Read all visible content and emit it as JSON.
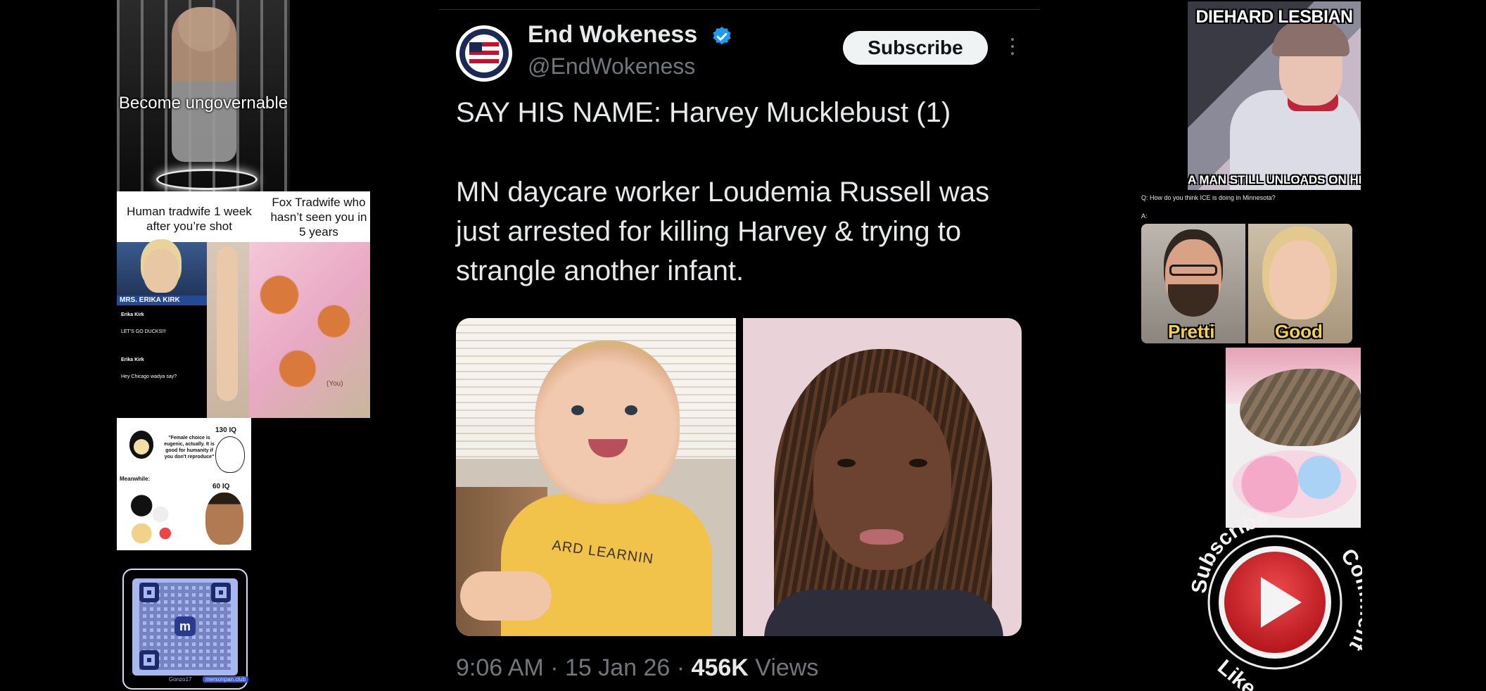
{
  "left_column": {
    "cage_meme": {
      "caption": "Become ungovernable"
    },
    "tradwife_meme": {
      "left_heading": "Human tradwife 1 week after you’re shot",
      "right_heading": "Fox Tradwife who hasn’t seen you in 5 years",
      "tv_name": "MRS. ERIKA KIRK",
      "tweet1_name": "Erika Kirk",
      "tweet1_text": "LET'S GO DUCKS!!!",
      "tweet2_name": "Erika Kirk",
      "tweet2_text": "Hey Chicago wadya say?",
      "fox_sign": "(You)"
    },
    "iq_meme": {
      "quote": "\"Female choice is eugenic, actually. It is good for humanity if you don't reproduce\"",
      "iq_high": "130 IQ",
      "meanwhile": "Meanwhile:",
      "iq_low": "60 IQ"
    },
    "qr_card": {
      "logo_letter": "m",
      "footer_name": "Gonzo17",
      "footer_badge": "mersonpan.club"
    }
  },
  "tweet": {
    "display_name": "End Wokeness",
    "handle": "@EndWokeness",
    "subscribe_label": "Subscribe",
    "line1": "SAY HIS NAME: Harvey Mucklebust (1)",
    "line2": "MN daycare worker Loudemia Russell was just arrested for killing Harvey & trying to strangle another infant.",
    "shirt_text": "ARD LEARNIN",
    "time": "9:06 AM · 15 Jan 26 ·",
    "views_count": "456K",
    "views_label": "Views",
    "colors": {
      "verified": "#1d9bf0",
      "muted": "#71767b",
      "text": "#e7e9ea"
    }
  },
  "right_column": {
    "diehard_meme": {
      "top_text": "DIEHARD LESBIAN",
      "bottom_text": "A MAN STILL UNLOADS ON HER FACE"
    },
    "ice_meme": {
      "question": "Q: How do you think ICE is doing in Minnesota?",
      "answer": "A:",
      "label_left": "Pretti",
      "label_right": "Good"
    },
    "yt_badge": {
      "subscribe": "Subscribe",
      "comment": "Comment",
      "like": "Like",
      "accent": "#d8262b"
    }
  }
}
